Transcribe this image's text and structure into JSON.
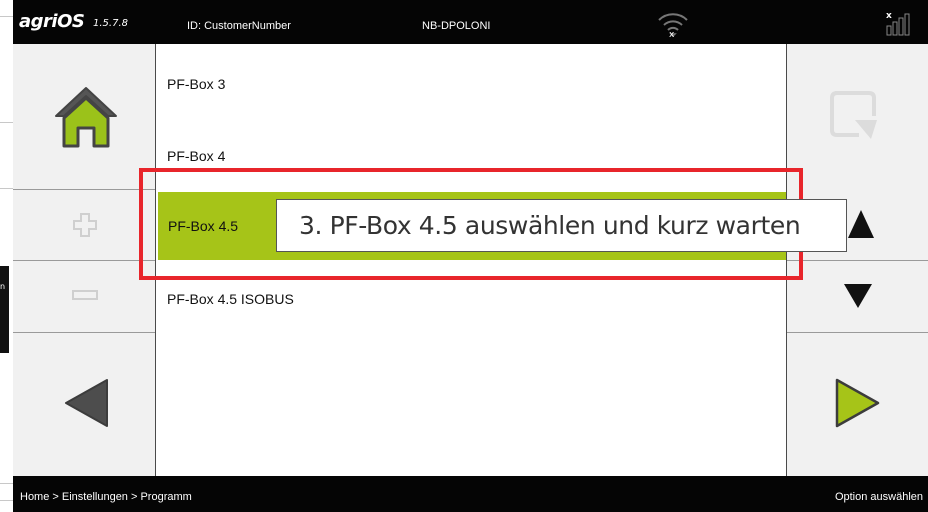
{
  "topbar": {
    "logo": "agriOS",
    "version": "1.5.7.8",
    "customer": "ID: CustomerNumber",
    "device": "NB-DPOLONI",
    "wifi_badge": "x",
    "signal_badge": "x"
  },
  "nav_left": {
    "home_icon": "home-icon",
    "plus_icon": "plus-icon",
    "minus_icon": "minus-icon",
    "back_icon": "arrow-left-icon"
  },
  "nav_right": {
    "confirm_icon": "confirm-icon",
    "up_icon": "arrow-up-icon",
    "down_icon": "arrow-down-icon",
    "forward_icon": "arrow-right-icon"
  },
  "list": {
    "items": [
      {
        "label": "PF-Box 3",
        "selected": false
      },
      {
        "label": "PF-Box 4",
        "selected": false
      },
      {
        "label": "PF-Box 4.5",
        "selected": true
      },
      {
        "label": "PF-Box 4.5 ISOBUS",
        "selected": false
      }
    ]
  },
  "annotation": {
    "text": "3. PF-Box 4.5 auswählen und kurz warten",
    "frame_color": "#e8252b"
  },
  "statusbar": {
    "breadcrumb": "Home > Einstellungen > Programm",
    "hint": "Option auswählen"
  },
  "page_edge": {
    "fragment": "n"
  },
  "colors": {
    "accent": "#a6c418",
    "bar": "#050505",
    "panel": "#f1f1f1"
  }
}
